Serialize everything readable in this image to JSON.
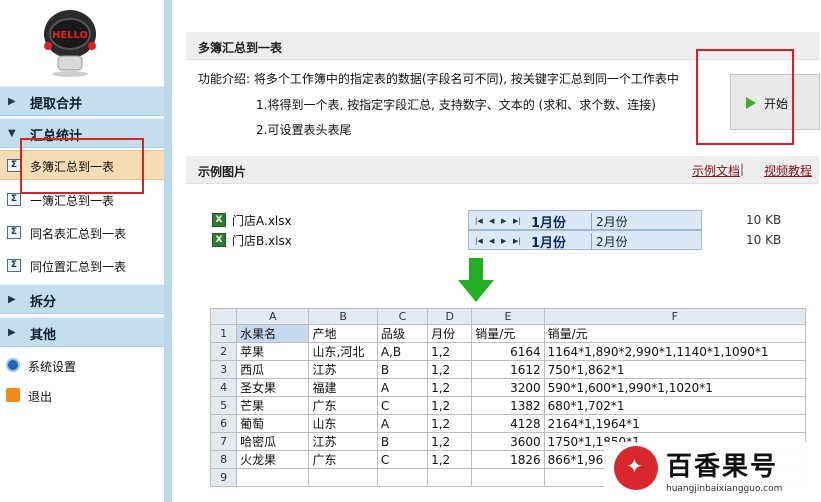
{
  "sidebar": {
    "logo_icon": "robot-mascot-icon",
    "logo_text": "HELLO",
    "groups": [
      {
        "label": "提取合并",
        "expanded": false
      },
      {
        "label": "汇总统计",
        "expanded": true
      },
      {
        "label": "拆分",
        "expanded": false
      },
      {
        "label": "其他",
        "expanded": false
      }
    ],
    "summary_items": [
      {
        "label": "多簿汇总到一表",
        "active": true
      },
      {
        "label": "一簿汇总到一表",
        "active": false
      },
      {
        "label": "同名表汇总到一表",
        "active": false
      },
      {
        "label": "同位置汇总到一表",
        "active": false
      }
    ],
    "misc_items": [
      {
        "label": "系统设置",
        "icon": "settings-icon"
      },
      {
        "label": "退出",
        "icon": "exit-icon"
      }
    ]
  },
  "main": {
    "section_title": "多簿汇总到一表",
    "description": "功能介绍: 将多个工作簿中的指定表的数据(字段名可不同), 按关键字汇总到同一个工作表中",
    "point1": "1.将得到一个表, 按指定字段汇总, 支持数字、文本的 (求和、求个数、连接)",
    "point2": "2.可设置表头表尾",
    "start_button": "开始",
    "example_title": "示例图片",
    "link_doc": "示例文档",
    "link_separator": "|",
    "link_video": "视频教程"
  },
  "example": {
    "files": [
      {
        "name": "门店A.xlsx",
        "size": "10 KB"
      },
      {
        "name": "门店B.xlsx",
        "size": "10 KB"
      }
    ],
    "tab_active": "1月份",
    "tab_inactive": "2月份",
    "sheet": {
      "columns": [
        "A",
        "B",
        "C",
        "D",
        "E",
        "F"
      ],
      "rows": [
        [
          "1",
          "水果名",
          "产地",
          "品级",
          "月份",
          "销量/元",
          "销量/元"
        ],
        [
          "2",
          "苹果",
          "山东,河北",
          "A,B",
          "1,2",
          "6164",
          "1164*1,890*2,990*1,1140*1,1090*1"
        ],
        [
          "3",
          "西瓜",
          "江苏",
          "B",
          "1,2",
          "1612",
          "750*1,862*1"
        ],
        [
          "4",
          "圣女果",
          "福建",
          "A",
          "1,2",
          "3200",
          "590*1,600*1,990*1,1020*1"
        ],
        [
          "5",
          "芒果",
          "广东",
          "C",
          "1,2",
          "1382",
          "680*1,702*1"
        ],
        [
          "6",
          "葡萄",
          "山东",
          "A",
          "1,2",
          "4128",
          "2164*1,1964*1"
        ],
        [
          "7",
          "哈密瓜",
          "江苏",
          "B",
          "1,2",
          "3600",
          "1750*1,1850*1"
        ],
        [
          "8",
          "火龙果",
          "广东",
          "C",
          "1,2",
          "1826",
          "866*1,960*1"
        ],
        [
          "9",
          "",
          "",
          "",
          "",
          "",
          ""
        ]
      ]
    }
  },
  "watermark": {
    "brand": "百香果号",
    "url": "huangjinbaixiangguo.com"
  }
}
